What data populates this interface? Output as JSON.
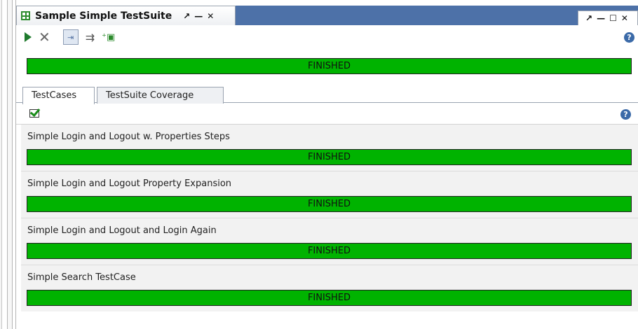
{
  "window": {
    "title": "Sample Simple TestSuite",
    "tab_controls": [
      "↗",
      "—",
      "✕"
    ],
    "window_controls": [
      "↗",
      "—",
      "☐",
      "✕"
    ]
  },
  "toolbar": {
    "buttons": [
      {
        "name": "run",
        "icon": "play-icon"
      },
      {
        "name": "cancel",
        "icon": "cancel-icon"
      },
      {
        "name": "sequential",
        "icon": "sequential-icon"
      },
      {
        "name": "parallel",
        "icon": "parallel-icon"
      },
      {
        "name": "new-testcase",
        "icon": "new-testcase-icon"
      }
    ],
    "help": "?"
  },
  "suite_progress": {
    "label": "FINISHED",
    "progress": 1.0,
    "color": "#00b300"
  },
  "tabs": [
    {
      "label": "TestCases",
      "active": true
    },
    {
      "label": "TestSuite Coverage",
      "active": false
    }
  ],
  "cases_help": "?",
  "test_cases": [
    {
      "name": "Simple Login and Logout w. Properties Steps",
      "status": "FINISHED",
      "progress": 1.0
    },
    {
      "name": "Simple Login and Logout Property Expansion",
      "status": "FINISHED",
      "progress": 1.0
    },
    {
      "name": "Simple Login and Logout and Login Again",
      "status": "FINISHED",
      "progress": 1.0
    },
    {
      "name": "Simple Search TestCase",
      "status": "FINISHED",
      "progress": 1.0
    }
  ],
  "colors": {
    "title_strip": "#4d71a8",
    "progress_green": "#00b300",
    "row_bg": "#f2f2f2"
  }
}
